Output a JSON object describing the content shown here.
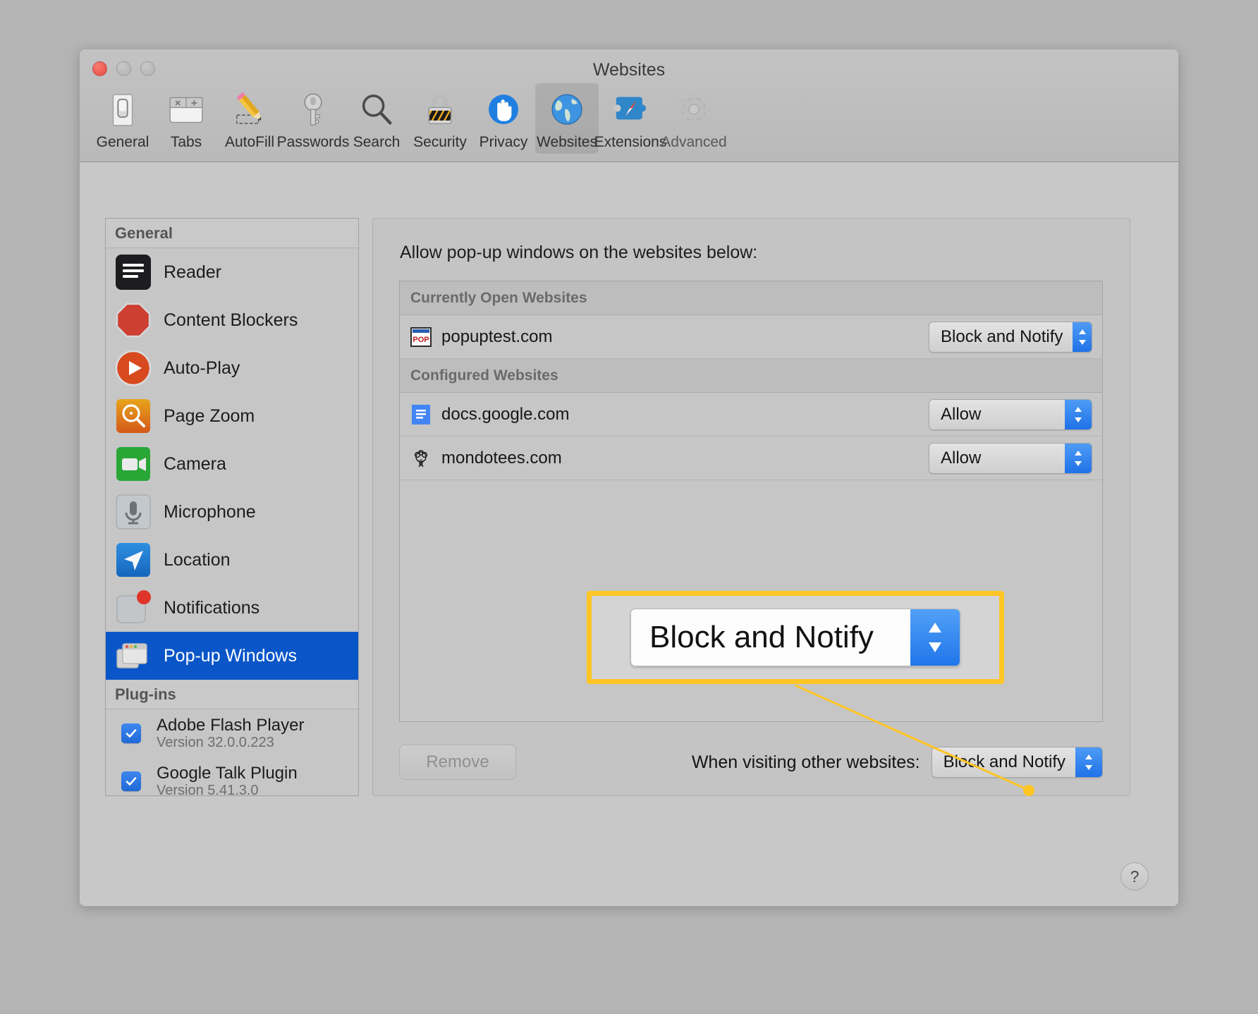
{
  "window": {
    "title": "Websites",
    "traffic_lights": [
      "close",
      "minimize",
      "zoom"
    ]
  },
  "toolbar": {
    "items": [
      {
        "label": "General",
        "icon": "general-switch-icon",
        "selected": false
      },
      {
        "label": "Tabs",
        "icon": "tabs-icon",
        "selected": false
      },
      {
        "label": "AutoFill",
        "icon": "autofill-pencil-icon",
        "selected": false
      },
      {
        "label": "Passwords",
        "icon": "key-icon",
        "selected": false
      },
      {
        "label": "Search",
        "icon": "magnifier-icon",
        "selected": false
      },
      {
        "label": "Security",
        "icon": "padlock-icon",
        "selected": false
      },
      {
        "label": "Privacy",
        "icon": "hand-icon",
        "selected": false
      },
      {
        "label": "Websites",
        "icon": "globe-icon",
        "selected": true
      },
      {
        "label": "Extensions",
        "icon": "puzzle-compass-icon",
        "selected": false
      },
      {
        "label": "Advanced",
        "icon": "gear-icon",
        "selected": false
      }
    ]
  },
  "sidebar": {
    "general_header": "General",
    "general_items": [
      {
        "label": "Reader",
        "icon": "reader-icon",
        "selected": false
      },
      {
        "label": "Content Blockers",
        "icon": "stop-sign-icon",
        "selected": false
      },
      {
        "label": "Auto-Play",
        "icon": "play-circle-icon",
        "selected": false
      },
      {
        "label": "Page Zoom",
        "icon": "zoom-in-icon",
        "selected": false
      },
      {
        "label": "Camera",
        "icon": "camera-icon",
        "selected": false
      },
      {
        "label": "Microphone",
        "icon": "microphone-icon",
        "selected": false
      },
      {
        "label": "Location",
        "icon": "location-arrow-icon",
        "selected": false
      },
      {
        "label": "Notifications",
        "icon": "notifications-icon",
        "selected": false
      },
      {
        "label": "Pop-up Windows",
        "icon": "popup-windows-icon",
        "selected": true
      }
    ],
    "plugins_header": "Plug-ins",
    "plugins": [
      {
        "name": "Adobe Flash Player",
        "version": "Version 32.0.0.223",
        "checked": true
      },
      {
        "name": "Google Talk Plugin",
        "version": "Version 5.41.3.0",
        "checked": true
      }
    ]
  },
  "main": {
    "intro": "Allow pop-up windows on the websites below:",
    "groups": [
      {
        "header": "Currently Open Websites",
        "rows": [
          {
            "site": "popuptest.com",
            "icon": "popuptest-favicon",
            "value": "Block and Notify"
          }
        ]
      },
      {
        "header": "Configured Websites",
        "rows": [
          {
            "site": "docs.google.com",
            "icon": "google-docs-favicon",
            "value": "Allow"
          },
          {
            "site": "mondotees.com",
            "icon": "mondotees-favicon",
            "value": "Allow"
          }
        ]
      }
    ],
    "remove_label": "Remove",
    "other_websites_label": "When visiting other websites:",
    "other_websites_value": "Block and Notify",
    "help_label": "?"
  },
  "callout": {
    "value": "Block and Notify",
    "highlight_color": "#ffc524"
  }
}
